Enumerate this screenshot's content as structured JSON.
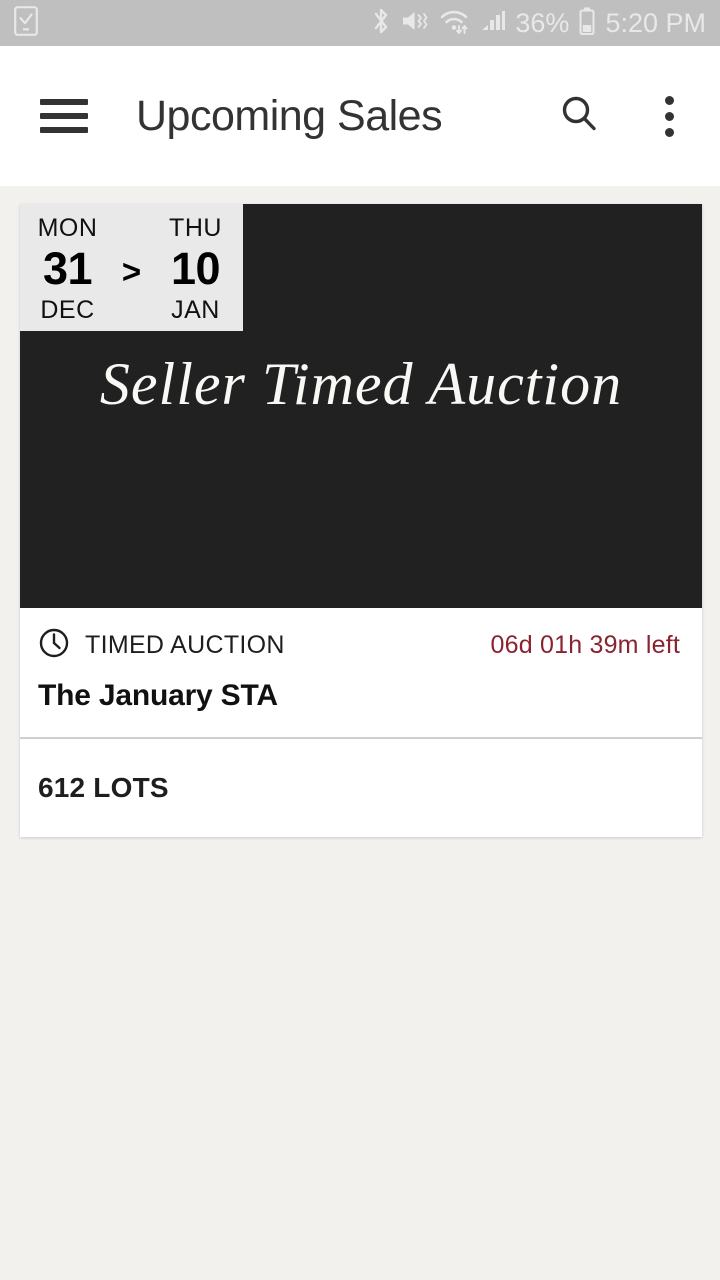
{
  "status_bar": {
    "left_icons": [
      {
        "name": "device-download-complete-icon",
        "glyph": "device-check"
      }
    ],
    "right_icons": [
      {
        "name": "bluetooth-icon",
        "glyph": "bluetooth"
      },
      {
        "name": "sound-mute-vibrate-icon",
        "glyph": "mute"
      },
      {
        "name": "wifi-icon",
        "glyph": "wifi-transfer"
      },
      {
        "name": "cellular-signal-icon",
        "glyph": "signal-bars"
      }
    ],
    "battery_percent": "36%",
    "battery_icon": "battery-icon",
    "clock": "5:20 PM",
    "background_color": "#BFBFBF",
    "text_color": "#E8E8E8"
  },
  "app_bar": {
    "menu_icon": "hamburger-menu-icon",
    "title": "Upcoming Sales",
    "search_icon": "search-icon",
    "overflow_icon": "more-vertical-icon",
    "background_color": "#FFFFFF",
    "title_color": "#333333"
  },
  "sale_card": {
    "banner": {
      "title": "Seller Timed Auction",
      "background_color": "#212121",
      "title_color": "#FAF8F5",
      "date_chip": {
        "background_color": "#E9E9E9",
        "start": {
          "weekday": "MON",
          "day": "31",
          "month": "DEC"
        },
        "separator": ">",
        "end": {
          "weekday": "THU",
          "day": "10",
          "month": "JAN"
        }
      }
    },
    "meta": {
      "type_icon": "clock-icon",
      "type_label": "TIMED AUCTION",
      "countdown": "06d 01h 39m left",
      "countdown_color": "#8A2330",
      "name": "The January STA"
    },
    "lots": {
      "label": "612 LOTS"
    }
  },
  "page": {
    "background_color": "#F2F1EE"
  }
}
